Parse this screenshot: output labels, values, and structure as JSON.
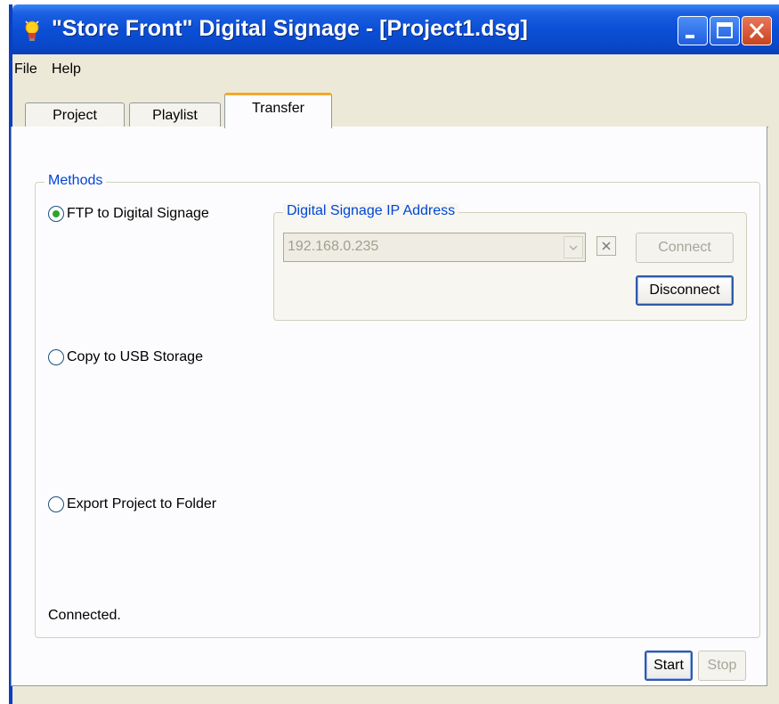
{
  "window": {
    "title": "\"Store Front\" Digital Signage - [Project1.dsg]"
  },
  "menu": {
    "items": [
      "File",
      "Help"
    ]
  },
  "tabs": [
    {
      "label": "Project",
      "active": false
    },
    {
      "label": "Playlist",
      "active": false
    },
    {
      "label": "Transfer",
      "active": true
    }
  ],
  "methods": {
    "title": "Methods",
    "options": [
      {
        "label": "FTP to Digital Signage",
        "selected": true
      },
      {
        "label": "Copy to USB Storage",
        "selected": false
      },
      {
        "label": "Export Project to Folder",
        "selected": false
      }
    ]
  },
  "ip_group": {
    "title": "Digital Signage IP Address",
    "ip_value": "192.168.0.235",
    "connect_label": "Connect",
    "disconnect_label": "Disconnect"
  },
  "status_text": "Connected.",
  "footer": {
    "start_label": "Start",
    "stop_label": "Stop"
  },
  "colors": {
    "titlebar": "#0b4fd6",
    "group_title": "#0046d5",
    "active_tab_accent": "#f2a92b",
    "radio_selected": "#2ca42c"
  },
  "icons": [
    "app-lightbulb-icon",
    "minimize-icon",
    "maximize-icon",
    "close-icon",
    "dropdown-arrow-icon",
    "clear-x-icon"
  ]
}
